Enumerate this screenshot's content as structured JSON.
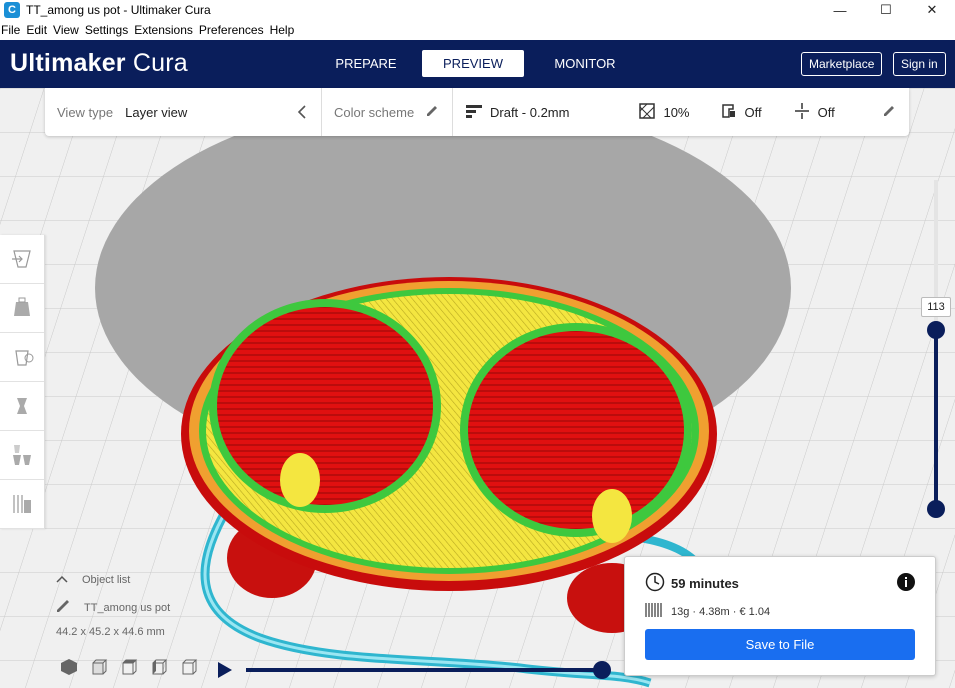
{
  "window": {
    "title": "TT_among us pot - Ultimaker Cura",
    "app_icon": "C"
  },
  "menu": [
    "File",
    "Edit",
    "View",
    "Settings",
    "Extensions",
    "Preferences",
    "Help"
  ],
  "header": {
    "logo_bold": "Ultimaker",
    "logo_light": "Cura",
    "stages": {
      "prepare": "PREPARE",
      "preview": "PREVIEW",
      "monitor": "MONITOR"
    },
    "marketplace": "Marketplace",
    "signin": "Sign in"
  },
  "viewbar": {
    "view_type_label": "View type",
    "view_type_value": "Layer view",
    "color_scheme_label": "Color scheme",
    "profile": "Draft - 0.2mm",
    "infill": "10%",
    "support": "Off",
    "adhesion": "Off"
  },
  "layer_slider": {
    "current_layer": "113"
  },
  "object_list": {
    "title": "Object list",
    "object_name": "TT_among us pot",
    "dimensions": "44.2 x 45.2 x 44.6 mm"
  },
  "print_info": {
    "time": "59 minutes",
    "material": "13g · 4.38m · € 1.04",
    "save_label": "Save to File"
  },
  "colors": {
    "header": "#0a1e5b",
    "accent": "#196ef0",
    "wall": "#e01010",
    "infill": "#f4e640",
    "inner_wall": "#3ec83e",
    "skin": "#f0a030",
    "travel": "#40c8e0"
  }
}
